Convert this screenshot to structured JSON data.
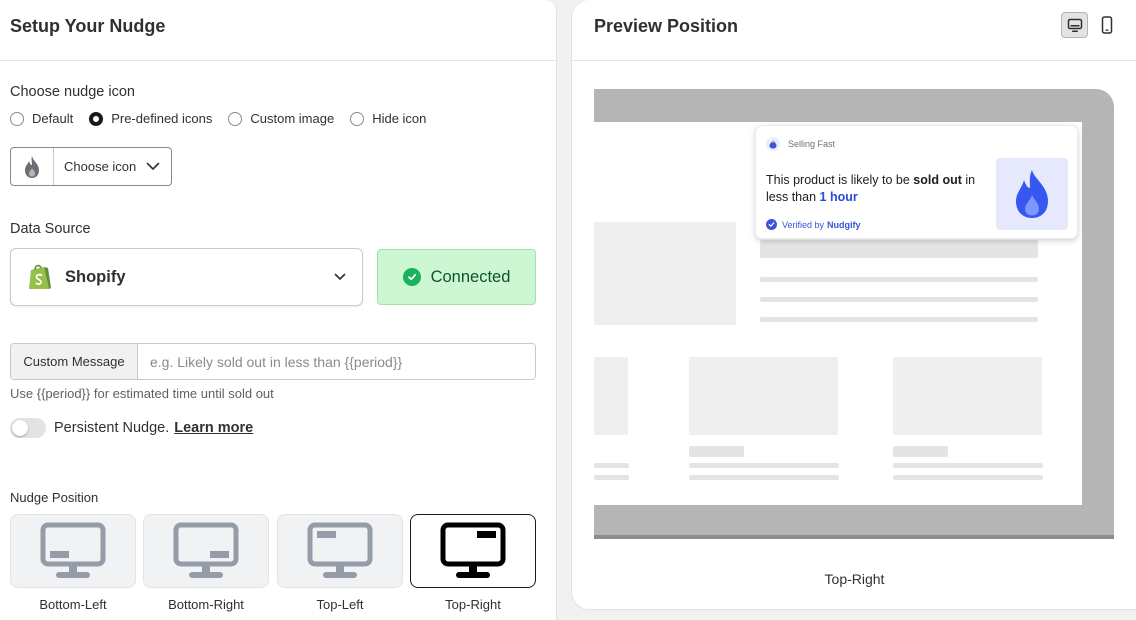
{
  "left": {
    "title": "Setup Your Nudge",
    "icon_section": {
      "label": "Choose nudge icon",
      "options": [
        "Default",
        "Pre-defined icons",
        "Custom image",
        "Hide icon"
      ],
      "selected": "Pre-defined icons",
      "picker_label": "Choose icon",
      "picker_icon": "flame-icon"
    },
    "data_source": {
      "label": "Data Source",
      "value": "Shopify",
      "status": "Connected"
    },
    "custom_message": {
      "prefix": "Custom Message",
      "placeholder": "e.g. Likely sold out in less than {{period}}",
      "value": "",
      "help": "Use {{period}} for estimated time until sold out"
    },
    "persistent": {
      "label": "Persistent Nudge.",
      "link": "Learn more",
      "enabled": false
    },
    "position": {
      "label": "Nudge Position",
      "options": [
        "Bottom-Left",
        "Bottom-Right",
        "Top-Left",
        "Top-Right"
      ],
      "selected": "Top-Right"
    }
  },
  "right": {
    "title": "Preview Position",
    "device_modes": [
      "desktop-icon",
      "mobile-icon"
    ],
    "active_device": "desktop",
    "nudge": {
      "header": "Selling Fast",
      "msg_pre": "This product is likely to be ",
      "msg_bold": "sold out",
      "msg_mid": " in less than ",
      "msg_highlight": "1 hour",
      "verified_pre": "Verified by",
      "verified_brand": "Nudgify"
    },
    "position_label": "Top-Right"
  },
  "colors": {
    "accent_blue": "#2c4bd8",
    "connected_bg": "#cdf7d2",
    "connected_text": "#0c5132",
    "shopify_green": "#5e8e3e"
  }
}
